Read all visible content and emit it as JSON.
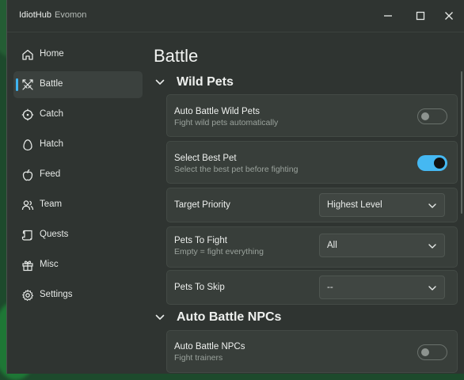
{
  "window": {
    "app_name": "IdiotHub",
    "game_name": "Evomon"
  },
  "sidebar": {
    "items": [
      {
        "label": "Home",
        "icon": "home-icon"
      },
      {
        "label": "Battle",
        "icon": "swords-icon",
        "active": true
      },
      {
        "label": "Catch",
        "icon": "target-icon"
      },
      {
        "label": "Hatch",
        "icon": "egg-icon"
      },
      {
        "label": "Feed",
        "icon": "apple-icon"
      },
      {
        "label": "Team",
        "icon": "users-icon"
      },
      {
        "label": "Quests",
        "icon": "scroll-icon"
      },
      {
        "label": "Misc",
        "icon": "gift-icon"
      },
      {
        "label": "Settings",
        "icon": "gear-icon"
      }
    ]
  },
  "main": {
    "title": "Battle",
    "sections": [
      {
        "title": "Wild Pets",
        "rows": [
          {
            "title": "Auto Battle Wild Pets",
            "description": "Fight wild pets automatically",
            "control": "toggle",
            "value": false
          },
          {
            "title": "Select Best Pet",
            "description": "Select the best pet before fighting",
            "control": "toggle",
            "value": true
          },
          {
            "title": "Target Priority",
            "description": "",
            "control": "dropdown",
            "value": "Highest Level"
          },
          {
            "title": "Pets To Fight",
            "description": "Empty = fight everything",
            "control": "dropdown",
            "value": "All"
          },
          {
            "title": "Pets To Skip",
            "description": "",
            "control": "dropdown",
            "value": "--"
          }
        ]
      },
      {
        "title": "Auto Battle NPCs",
        "rows": [
          {
            "title": "Auto Battle NPCs",
            "description": "Fight trainers",
            "control": "toggle",
            "value": false
          }
        ]
      }
    ]
  },
  "colors": {
    "accent": "#45b8f2",
    "window_bg": "#2f3431",
    "card_bg": "#383e3a"
  }
}
